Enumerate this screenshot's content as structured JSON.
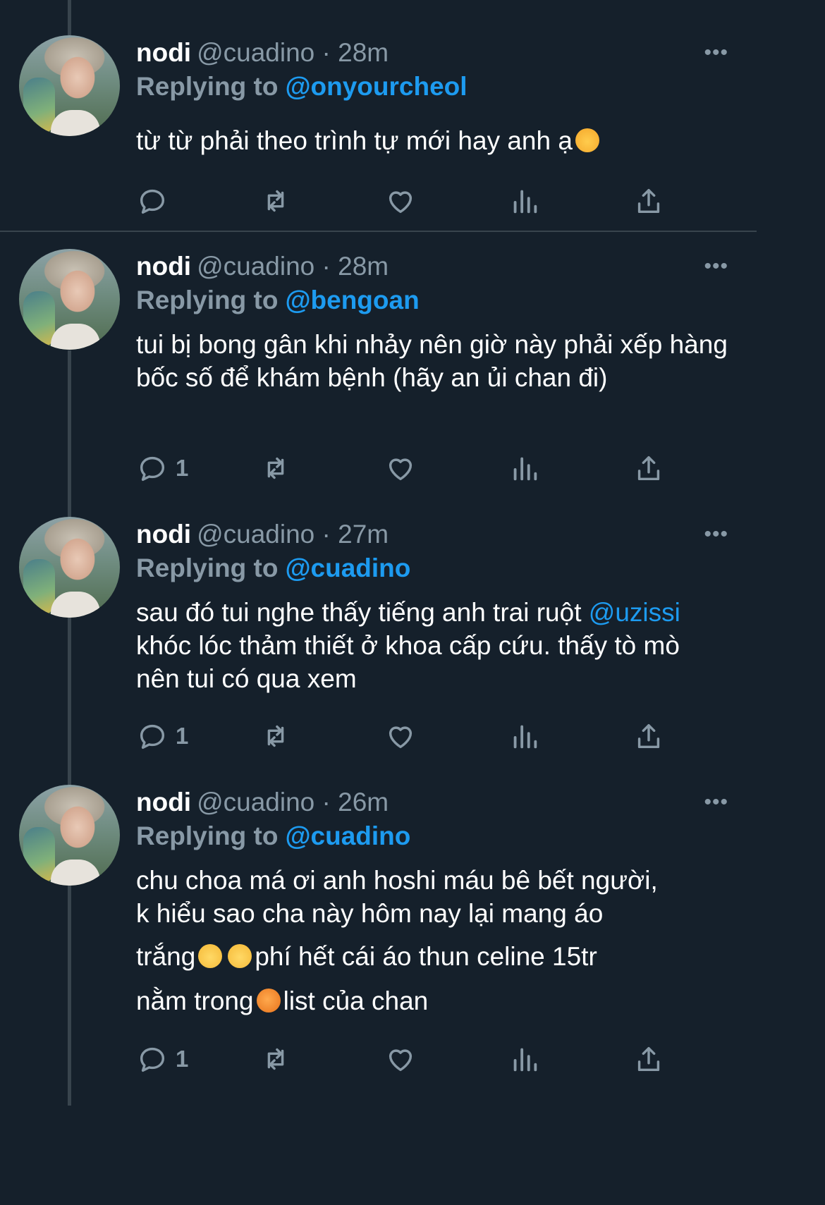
{
  "tweets": [
    {
      "name": "nodi",
      "handle": "@cuadino",
      "time": "28m",
      "replying_label": "Replying to",
      "replying_to": "@onyourcheol",
      "text_before": "từ từ phải theo trình tự mới hay anh ạ",
      "reply_count": ""
    },
    {
      "name": "nodi",
      "handle": "@cuadino",
      "time": "28m",
      "replying_label": "Replying to",
      "replying_to": "@bengoan",
      "text": "tui bị bong gân khi nhảy nên giờ này phải xếp hàng bốc số để khám bệnh (hãy an ủi chan đi)",
      "reply_count": "1"
    },
    {
      "name": "nodi",
      "handle": "@cuadino",
      "time": "27m",
      "replying_label": "Replying to",
      "replying_to": "@cuadino",
      "text_before": "sau đó tui nghe thấy tiếng anh trai ruột",
      "mention": "@uzissi",
      "text_after": "khóc lóc thảm thiết ở khoa cấp cứu. thấy tò mò nên tui có qua xem",
      "reply_count": "1"
    },
    {
      "name": "nodi",
      "handle": "@cuadino",
      "time": "26m",
      "replying_label": "Replying to",
      "replying_to": "@cuadino",
      "line1": "chu choa má ơi anh hoshi máu bê bết người,",
      "line2": "k hiểu sao cha này hôm nay lại mang áo",
      "line3_a": "trắng",
      "line3_b": "phí hết cái áo thun celine 15tr",
      "line4_a": "nằm trong",
      "line4_b": "list của chan",
      "reply_count": "1"
    }
  ],
  "more_label": "•••",
  "separator": "·",
  "colors": {
    "background": "#15202b",
    "secondary": "#8899a6",
    "accent": "#1d9bf0",
    "line": "#38444d"
  },
  "icons": [
    "reply-icon",
    "retweet-icon",
    "like-icon",
    "analytics-icon",
    "share-icon",
    "more-icon"
  ]
}
